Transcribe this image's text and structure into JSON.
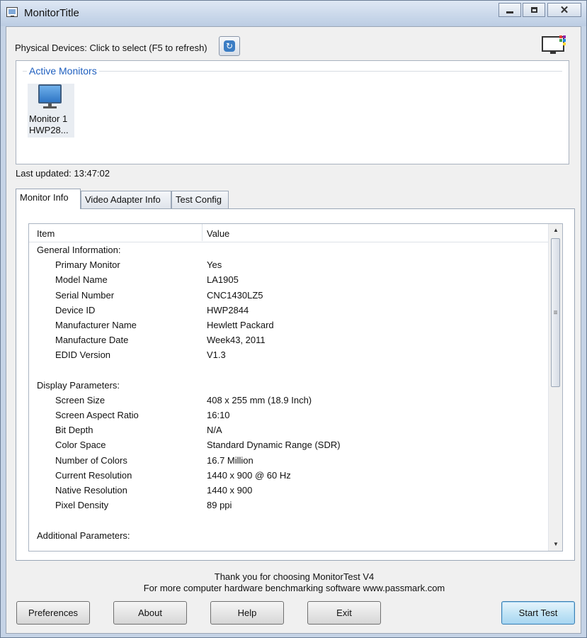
{
  "window": {
    "title": "MonitorTitle"
  },
  "toolbar": {
    "physical_devices_label": "Physical Devices: Click to select (F5 to refresh)"
  },
  "active_monitors": {
    "label": "Active Monitors",
    "items": [
      {
        "name": "Monitor 1",
        "id": "HWP28..."
      }
    ]
  },
  "status": {
    "last_updated": "Last updated: 13:47:02"
  },
  "tabs": [
    {
      "label": "Monitor Info",
      "active": true
    },
    {
      "label": "Video Adapter Info",
      "active": false
    },
    {
      "label": "Test Config",
      "active": false
    }
  ],
  "table": {
    "columns": [
      "Item",
      "Value"
    ],
    "rows": [
      {
        "item": "General Information:",
        "value": "",
        "kind": "group"
      },
      {
        "item": "Primary Monitor",
        "value": "Yes",
        "kind": "sub"
      },
      {
        "item": "Model Name",
        "value": "LA1905",
        "kind": "sub"
      },
      {
        "item": "Serial Number",
        "value": "CNC1430LZ5",
        "kind": "sub"
      },
      {
        "item": "Device ID",
        "value": "HWP2844",
        "kind": "sub"
      },
      {
        "item": "Manufacturer Name",
        "value": "Hewlett Packard",
        "kind": "sub"
      },
      {
        "item": "Manufacture Date",
        "value": "Week43, 2011",
        "kind": "sub"
      },
      {
        "item": "EDID Version",
        "value": "V1.3",
        "kind": "sub"
      },
      {
        "item": "",
        "value": "",
        "kind": "blank"
      },
      {
        "item": "Display Parameters:",
        "value": "",
        "kind": "group"
      },
      {
        "item": "Screen Size",
        "value": "408 x 255 mm (18.9 Inch)",
        "kind": "sub"
      },
      {
        "item": "Screen Aspect Ratio",
        "value": "16:10",
        "kind": "sub"
      },
      {
        "item": "Bit Depth",
        "value": "N/A",
        "kind": "sub"
      },
      {
        "item": "Color Space",
        "value": "Standard Dynamic Range (SDR)",
        "kind": "sub"
      },
      {
        "item": "Number of Colors",
        "value": "16.7 Million",
        "kind": "sub"
      },
      {
        "item": "Current Resolution",
        "value": "1440 x 900 @ 60 Hz",
        "kind": "sub"
      },
      {
        "item": "Native Resolution",
        "value": "1440 x 900",
        "kind": "sub"
      },
      {
        "item": "Pixel Density",
        "value": "89 ppi",
        "kind": "sub"
      },
      {
        "item": "",
        "value": "",
        "kind": "blank"
      },
      {
        "item": "Additional Parameters:",
        "value": "",
        "kind": "group"
      }
    ]
  },
  "footer": {
    "thanks_line1": "Thank you for choosing MonitorTest V4",
    "thanks_line2": "For more computer hardware benchmarking software www.passmark.com"
  },
  "buttons": {
    "preferences": "Preferences",
    "about": "About",
    "help": "Help",
    "exit": "Exit",
    "start_test": "Start Test"
  }
}
